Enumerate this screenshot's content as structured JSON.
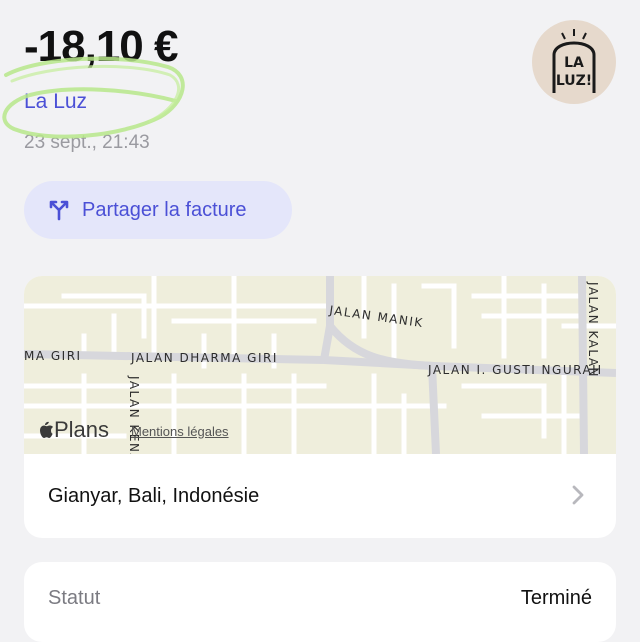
{
  "transaction": {
    "amount": "-18,10 €",
    "merchant": "La Luz",
    "datetime": "23 sept., 21:43",
    "logo_text": "LA LUZ!"
  },
  "actions": {
    "split_bill_label": "Partager la facture"
  },
  "map": {
    "provider": "Plans",
    "legal_label": "Mentions légales",
    "streets": {
      "manik": "JALAN MANIK",
      "dharma_giri": "JALAN DHARMA GIRI",
      "dharma_giri_left": "MA GIRI",
      "gusti_ngurah": "JALAN I. GUSTI NGURAH",
      "kalan": "JALAN KALAN",
      "kenari": "JALAN KENARI"
    }
  },
  "location": {
    "label": "Gianyar, Bali, Indonésie"
  },
  "status": {
    "label": "Statut",
    "value": "Terminé"
  },
  "colors": {
    "accent": "#4b50d6",
    "accent_bg": "#e4e6fa",
    "scribble": "#b7e88a"
  }
}
